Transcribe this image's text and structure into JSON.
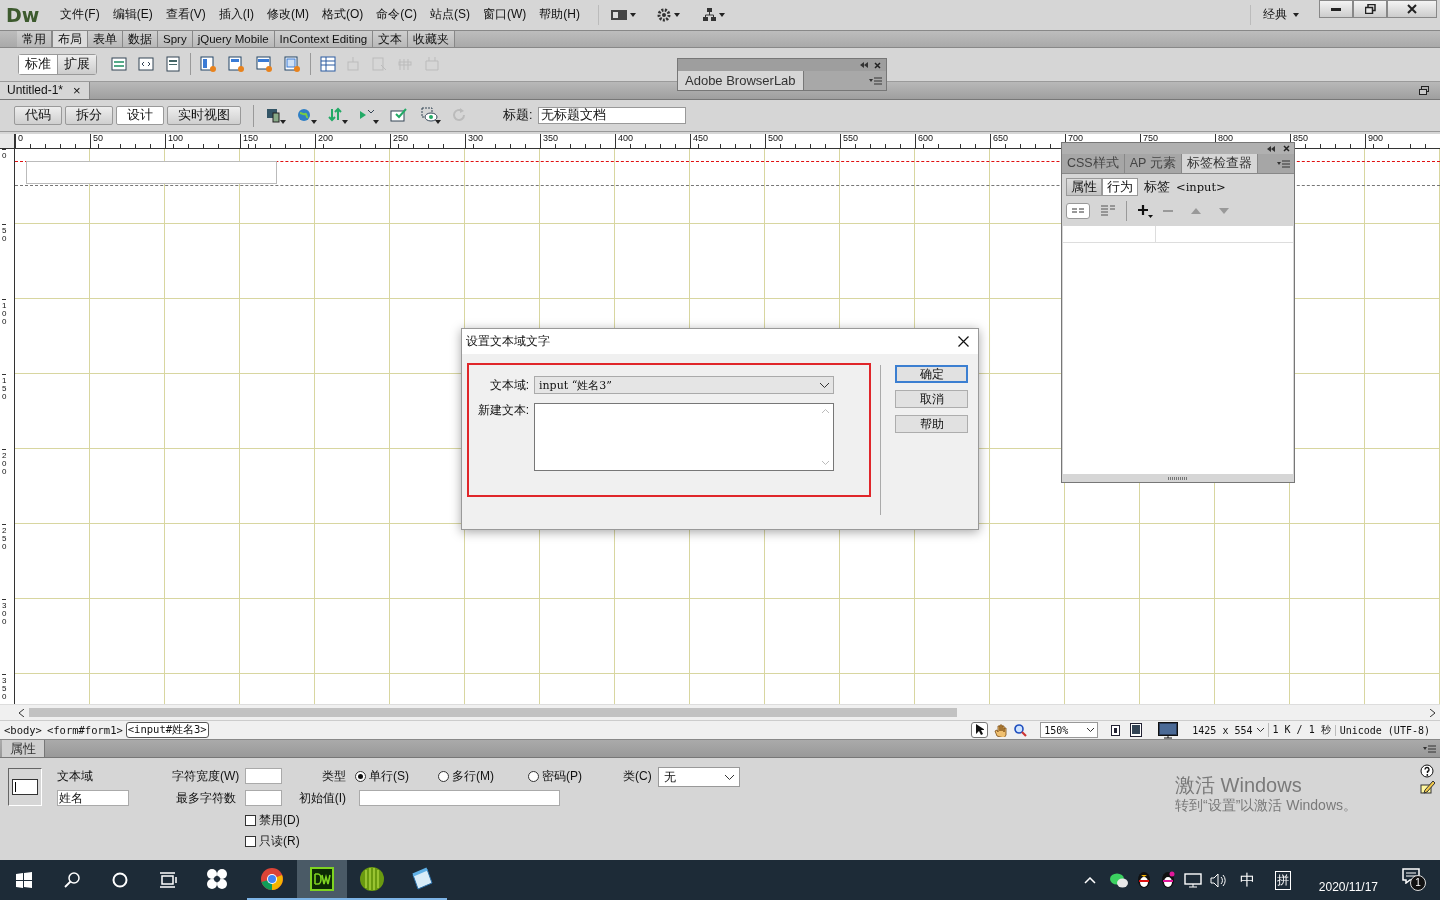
{
  "app": {
    "logo": "Dw",
    "menu": [
      "文件(F)",
      "编辑(E)",
      "查看(V)",
      "插入(I)",
      "修改(M)",
      "格式(O)",
      "命令(C)",
      "站点(S)",
      "窗口(W)",
      "帮助(H)"
    ],
    "workspace": "经典"
  },
  "insert_bar": {
    "tabs": [
      {
        "label": "常用",
        "selected": false
      },
      {
        "label": "布局",
        "selected": true
      },
      {
        "label": "表单",
        "selected": false
      },
      {
        "label": "数据",
        "selected": false
      },
      {
        "label": "Spry",
        "selected": false
      },
      {
        "label": "jQuery Mobile",
        "selected": false
      },
      {
        "label": "InContext Editing",
        "selected": false
      },
      {
        "label": "文本",
        "selected": false
      },
      {
        "label": "收藏夹",
        "selected": false
      }
    ],
    "modes": [
      {
        "label": "标准",
        "selected": true
      },
      {
        "label": "扩展",
        "selected": false
      }
    ]
  },
  "browserlab_panel": {
    "tab": "Adobe BrowserLab"
  },
  "document_tab": {
    "title": "Untitled-1*",
    "close": "×"
  },
  "document_toolbar": {
    "views": [
      {
        "label": "代码",
        "selected": false
      },
      {
        "label": "拆分",
        "selected": false
      },
      {
        "label": "设计",
        "selected": true
      },
      {
        "label": "实时视图",
        "selected": false
      }
    ],
    "title_label": "标题:",
    "title_value": "无标题文档"
  },
  "ruler": {
    "horizontal": [
      "0",
      "50",
      "100",
      "150",
      "200",
      "250",
      "300",
      "350",
      "400",
      "450",
      "500",
      "550",
      "600",
      "650",
      "700",
      "750",
      "800",
      "850",
      "900"
    ],
    "vertical": [
      "0",
      "50",
      "100",
      "150",
      "200",
      "250",
      "300",
      "350"
    ]
  },
  "tag_inspector": {
    "tabs": [
      {
        "label": "CSS样式",
        "selected": false
      },
      {
        "label": "AP 元素",
        "selected": false
      },
      {
        "label": "标签检查器",
        "selected": true
      }
    ],
    "subtabs": [
      {
        "label": "属性",
        "selected": false
      },
      {
        "label": "行为",
        "selected": true
      }
    ],
    "tag_label": "标签",
    "tag": "<input>"
  },
  "dialog": {
    "title": "设置文本域文字",
    "field_label": "文本域:",
    "field_value": "input “姓名3”",
    "new_text_label": "新建文本:",
    "buttons": [
      "确定",
      "取消",
      "帮助"
    ]
  },
  "status_bar": {
    "tags": [
      {
        "label": "<body>",
        "selected": false
      },
      {
        "label": "<form#form1>",
        "selected": false
      },
      {
        "label": "<input#姓名3>",
        "selected": true
      }
    ],
    "zoom": "150%",
    "size": "1425 x 554",
    "download": "1 K / 1 秒",
    "encoding": "Unicode (UTF-8)"
  },
  "properties": {
    "tab": "属性",
    "kind_label": "文本域",
    "name": "姓名",
    "char_width_label": "字符宽度(W)",
    "max_chars_label": "最多字符数",
    "type_label": "类型",
    "types": [
      {
        "label": "单行(S)",
        "selected": true
      },
      {
        "label": "多行(M)",
        "selected": false
      },
      {
        "label": "密码(P)",
        "selected": false
      }
    ],
    "init_label": "初始值(I)",
    "class_label": "类(C)",
    "class_value": "无",
    "options": [
      {
        "label": "禁用(D)",
        "checked": false
      },
      {
        "label": "只读(R)",
        "checked": false
      }
    ]
  },
  "activation": {
    "title": "激活 Windows",
    "text": "转到“设置”以激活 Windows。"
  },
  "taskbar": {
    "apps": [
      {
        "running": false,
        "selected": false
      },
      {
        "running": true,
        "selected": false
      },
      {
        "running": true,
        "selected": true
      },
      {
        "running": true,
        "selected": false
      },
      {
        "running": true,
        "selected": false
      }
    ],
    "ime": "中",
    "ime_mode": "拼",
    "date": "2020/11/17",
    "notifications": "1"
  }
}
